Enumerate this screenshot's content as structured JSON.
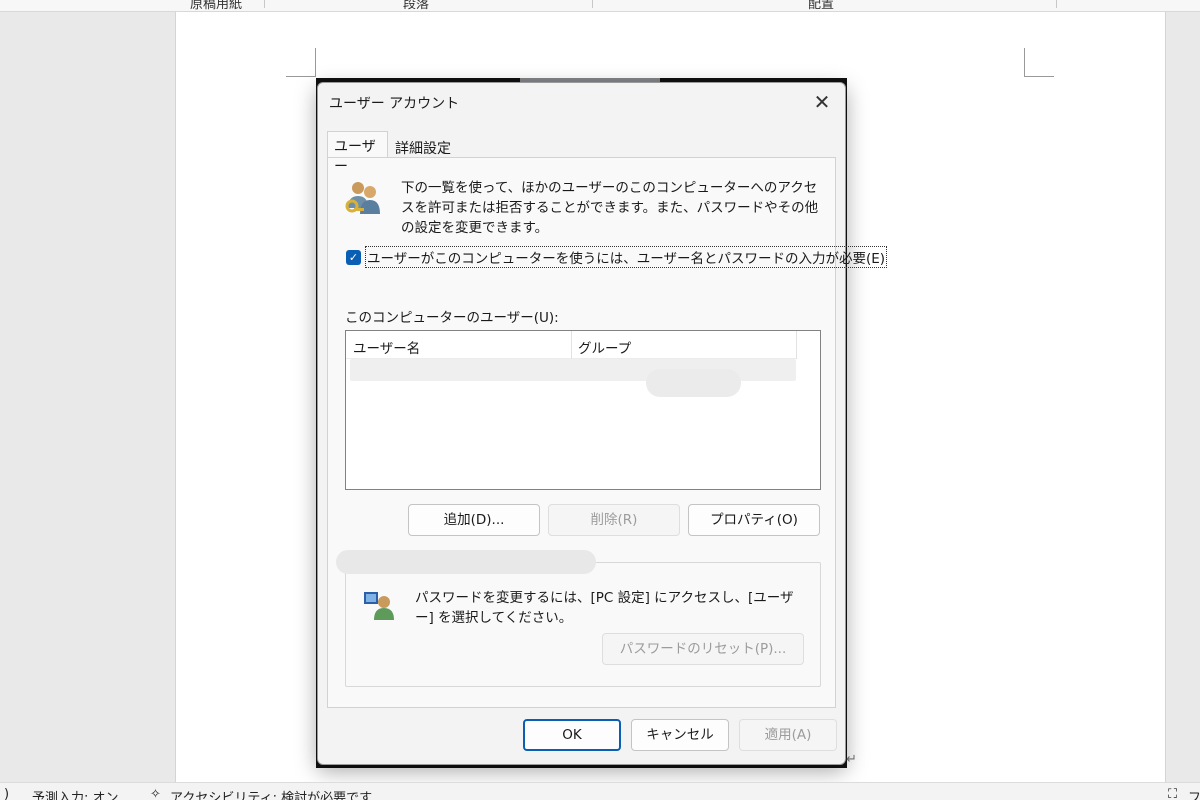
{
  "ribbon": {
    "group1": "原稿用紙",
    "group2": "段落",
    "group3": "配置"
  },
  "statusbar": {
    "left_fragment": ")",
    "predictive_input": "予測入力: オン",
    "accessibility": "アクセシビリティ: 検討が必要です",
    "right_fragment": "フ"
  },
  "dialog": {
    "title": "ユーザー アカウント",
    "tabs": [
      {
        "label": "ユーザー",
        "active": true
      },
      {
        "label": "詳細設定",
        "active": false
      }
    ],
    "intro_text": "下の一覧を使って、ほかのユーザーのこのコンピューターへのアクセスを許可または拒否することができます。また、パスワードやその他の設定を変更できます。",
    "require_login": {
      "label": "ユーザーがこのコンピューターを使うには、ユーザー名とパスワードの入力が必要(E)",
      "checked": true
    },
    "users_list": {
      "label": "このコンピューターのユーザー(U):",
      "columns": [
        "ユーザー名",
        "グループ"
      ]
    },
    "buttons": {
      "add": "追加(D)...",
      "remove": "削除(R)",
      "properties": "プロパティ(O)"
    },
    "password_section": {
      "text": "パスワードを変更するには、[PC 設定] にアクセスし、[ユーザー] を選択してください。",
      "reset_button": "パスワードのリセット(P)..."
    },
    "footer": {
      "ok": "OK",
      "cancel": "キャンセル",
      "apply": "適用(A)"
    }
  },
  "colors": {
    "accent": "#0a5fb4",
    "dialog_bg": "#f3f3f3",
    "panel_bg": "#f9f9f9"
  }
}
